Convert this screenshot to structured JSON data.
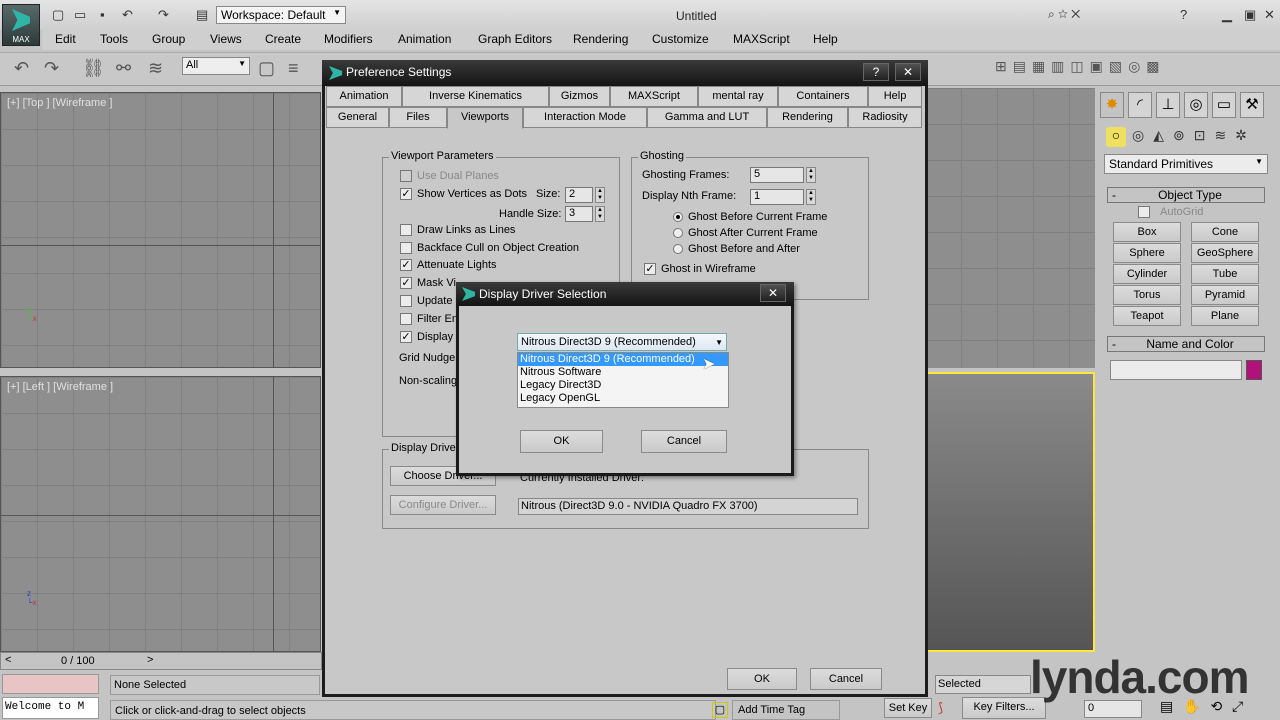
{
  "app": {
    "title": "Untitled",
    "logo_label": "MAX",
    "workspace": "Workspace: Default"
  },
  "menu": [
    "Edit",
    "Tools",
    "Group",
    "Views",
    "Create",
    "Modifiers",
    "Animation",
    "Graph Editors",
    "Rendering",
    "Customize",
    "MAXScript",
    "Help"
  ],
  "toolbar": {
    "selection_filter": "All"
  },
  "viewports": {
    "top": "[+] [Top ] [Wireframe ]",
    "left": "[+] [Left ] [Wireframe ]"
  },
  "timeline": {
    "frame": "0 / 100"
  },
  "command_panel": {
    "category": "Standard Primitives",
    "object_type_header": "Object Type",
    "autogrid": "AutoGrid",
    "buttons": [
      "Box",
      "Cone",
      "Sphere",
      "GeoSphere",
      "Cylinder",
      "Tube",
      "Torus",
      "Pyramid",
      "Teapot",
      "Plane"
    ],
    "name_color_header": "Name and Color",
    "object_color": "#b0127a"
  },
  "preference": {
    "title": "Preference Settings",
    "tabs_row1": [
      "Animation",
      "Inverse Kinematics",
      "Gizmos",
      "MAXScript",
      "mental ray",
      "Containers",
      "Help"
    ],
    "tabs_row2": [
      "General",
      "Files",
      "Viewports",
      "Interaction Mode",
      "Gamma and LUT",
      "Rendering",
      "Radiosity"
    ],
    "viewport_params": {
      "label": "Viewport Parameters",
      "use_dual_planes": "Use Dual Planes",
      "show_vertices": "Show Vertices as Dots",
      "size_label": "Size:",
      "size": "2",
      "handle_size_label": "Handle Size:",
      "handle_size": "3",
      "draw_links": "Draw Links as Lines",
      "backface": "Backface Cull on Object Creation",
      "attenuate": "Attenuate Lights",
      "mask": "Mask Vi",
      "update": "Update",
      "filter": "Filter En",
      "display": "Display",
      "grid_nudge": "Grid Nudge",
      "non_scaling": "Non-scaling"
    },
    "ghosting": {
      "label": "Ghosting",
      "frames_label": "Ghosting Frames:",
      "frames": "5",
      "nth_label": "Display Nth Frame:",
      "nth": "1",
      "before": "Ghost Before Current Frame",
      "after": "Ghost After Current Frame",
      "both": "Ghost Before and After",
      "wireframe": "Ghost in Wireframe"
    },
    "display_drivers": {
      "label": "Display Driver",
      "choose": "Choose Driver...",
      "configure": "Configure Driver...",
      "current_label": "Currently Installed Driver:",
      "current": "Nitrous (Direct3D 9.0 - NVIDIA Quadro FX 3700)"
    },
    "ok": "OK",
    "cancel": "Cancel"
  },
  "driver_dialog": {
    "title": "Display Driver Selection",
    "selected": "Nitrous Direct3D 9 (Recommended)",
    "options": [
      "Nitrous Direct3D 9 (Recommended)",
      "Nitrous Software",
      "Legacy Direct3D",
      "Legacy OpenGL"
    ],
    "ok": "OK",
    "cancel": "Cancel"
  },
  "status": {
    "listener": "Welcome to M",
    "selection": "None Selected",
    "prompt": "Click or click-and-drag to select objects",
    "add_time_tag": "Add Time Tag",
    "set_key": "Set Key",
    "key_filters": "Key Filters...",
    "selected": "Selected",
    "frame": "0"
  },
  "watermark": "lynda.com"
}
